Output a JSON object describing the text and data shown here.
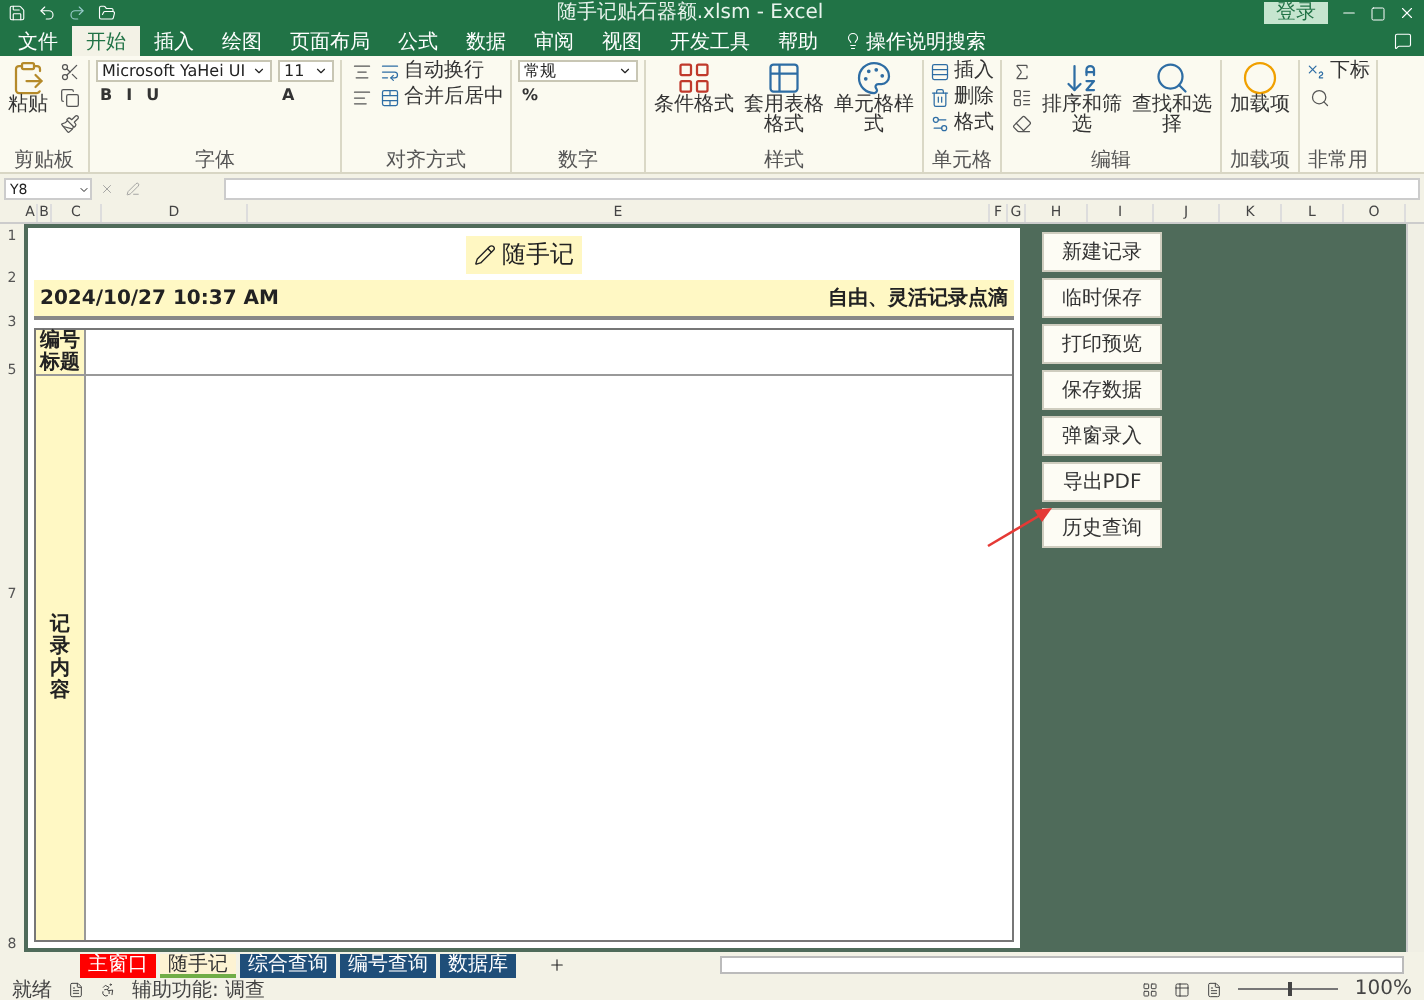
{
  "window": {
    "title": "随手记贴石器额.xlsm - Excel",
    "sign_in": "登录"
  },
  "menu_tabs": [
    {
      "label": "文件",
      "selected": false
    },
    {
      "label": "开始",
      "selected": true
    },
    {
      "label": "插入",
      "selected": false
    },
    {
      "label": "绘图",
      "selected": false
    },
    {
      "label": "页面布局",
      "selected": false
    },
    {
      "label": "公式",
      "selected": false
    },
    {
      "label": "数据",
      "selected": false
    },
    {
      "label": "审阅",
      "selected": false
    },
    {
      "label": "视图",
      "selected": false
    },
    {
      "label": "开发工具",
      "selected": false
    },
    {
      "label": "帮助",
      "selected": false
    }
  ],
  "tell_me": "操作说明搜索",
  "ribbon_groups": [
    {
      "title": "剪贴板",
      "columns": [
        [
          {
            "kind": "big",
            "label": "粘贴"
          }
        ],
        [
          {
            "kind": "tool"
          },
          {
            "kind": "tool"
          },
          {
            "kind": "tool"
          }
        ]
      ]
    },
    {
      "title": "字体",
      "columns": [
        [
          {
            "kind": "field",
            "value": "Microsoft YaHei UI"
          },
          {
            "kind": "letters",
            "labels": [
              "B",
              "I",
              "U"
            ]
          }
        ],
        [
          {
            "kind": "field",
            "value": "11"
          },
          {
            "kind": "letters",
            "labels": [
              "A"
            ]
          }
        ]
      ]
    },
    {
      "title": "对齐方式",
      "columns": [
        [
          {
            "kind": "tool"
          },
          {
            "kind": "tool"
          }
        ],
        [
          {
            "kind": "small",
            "label": "自动换行"
          },
          {
            "kind": "small",
            "label": "合并后居中"
          }
        ]
      ]
    },
    {
      "title": "数字",
      "columns": [
        [
          {
            "kind": "field",
            "value": "常规"
          },
          {
            "kind": "letters",
            "labels": [
              "%"
            ]
          }
        ]
      ]
    },
    {
      "title": "样式",
      "columns": [
        [
          {
            "kind": "big",
            "label": "条件格式"
          }
        ],
        [
          {
            "kind": "big",
            "label": "套用表格格式"
          }
        ],
        [
          {
            "kind": "big",
            "label": "单元格样式"
          }
        ]
      ]
    },
    {
      "title": "单元格",
      "columns": [
        [
          {
            "kind": "small",
            "label": "插入"
          },
          {
            "kind": "small",
            "label": "删除"
          },
          {
            "kind": "small",
            "label": "格式"
          }
        ]
      ]
    },
    {
      "title": "编辑",
      "columns": [
        [
          {
            "kind": "tool"
          },
          {
            "kind": "tool"
          },
          {
            "kind": "tool"
          }
        ],
        [
          {
            "kind": "big",
            "label": "排序和筛选"
          }
        ],
        [
          {
            "kind": "big",
            "label": "查找和选择"
          }
        ]
      ]
    },
    {
      "title": "加载项",
      "columns": [
        [
          {
            "kind": "big",
            "label": "加载项"
          }
        ]
      ]
    },
    {
      "title": "非常用",
      "columns": [
        [
          {
            "kind": "small",
            "label": "下标"
          },
          {
            "kind": "tool"
          }
        ]
      ]
    }
  ],
  "formula_bar": {
    "name_box": "Y8"
  },
  "columns": [
    "A",
    "B",
    "C",
    "D",
    "E",
    "F",
    "G",
    "H",
    "I",
    "J",
    "K",
    "L",
    "O"
  ],
  "rows": [
    "1",
    "2",
    "3",
    "5",
    "7",
    "8"
  ],
  "form": {
    "title": "随手记",
    "date": "2024/10/27 10:37 AM",
    "slogan": "自由、灵活记录点滴",
    "title_labels": [
      "编号",
      "标题"
    ],
    "content_label": "记录内容"
  },
  "buttons": [
    "新建记录",
    "临时保存",
    "打印预览",
    "保存数据",
    "弹窗录入",
    "导出PDF",
    "历史查询"
  ],
  "sheet_tabs": [
    {
      "label": "主窗口",
      "selected": false,
      "color": "#ff0000"
    },
    {
      "label": "随手记",
      "selected": true,
      "color": "#70ad47"
    },
    {
      "label": "综合查询",
      "selected": false,
      "color": "#1f4e79"
    },
    {
      "label": "编号查询",
      "selected": false,
      "color": "#1f4e79"
    },
    {
      "label": "数据库",
      "selected": false,
      "color": "#1f4e79"
    }
  ],
  "status_bar": {
    "ready": "就绪",
    "accessibility": "辅助功能: 调查",
    "zoom_slider": {
      "level": 0.5
    },
    "zoom": "100%"
  }
}
